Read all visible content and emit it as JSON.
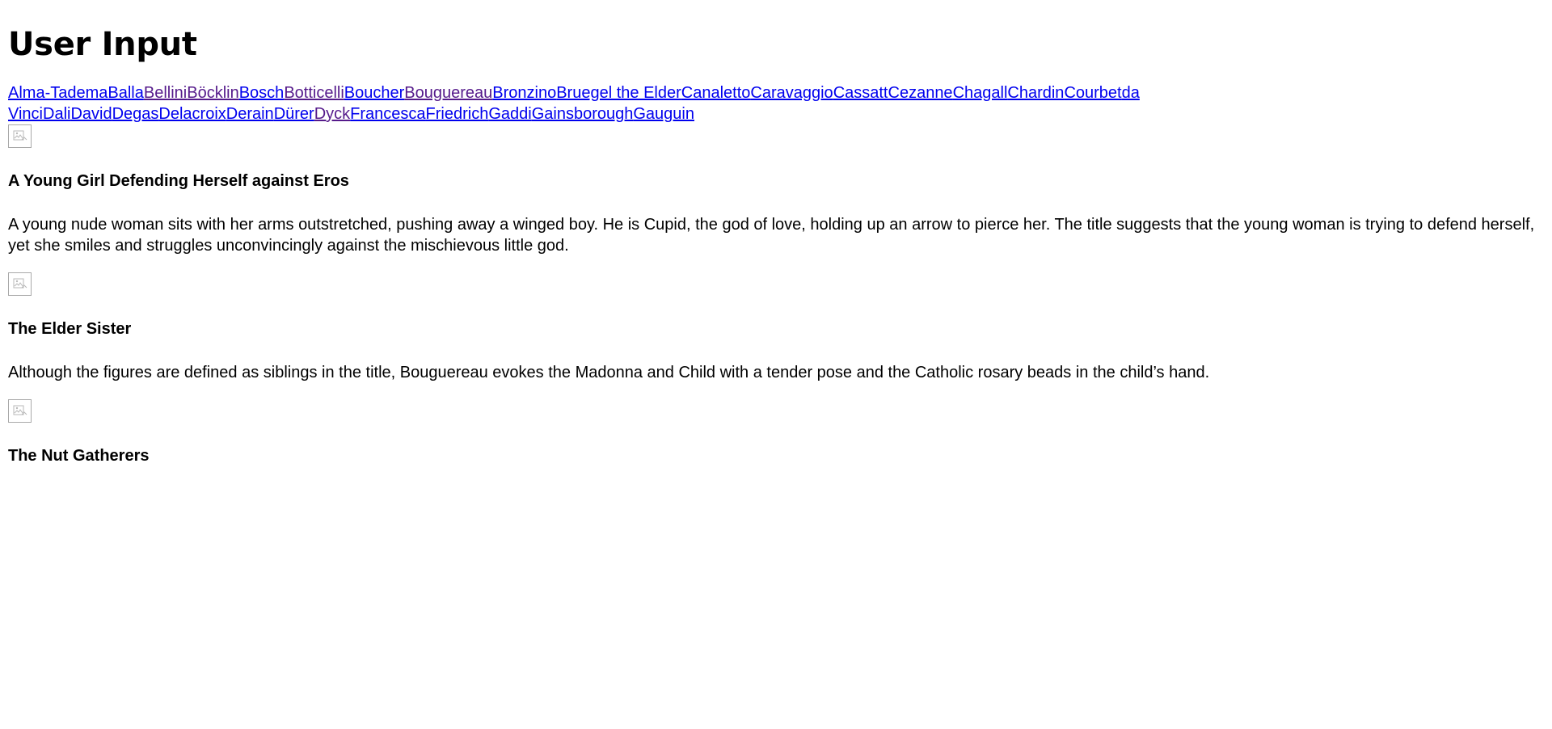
{
  "page": {
    "title": "User Input"
  },
  "artists": [
    {
      "label": "Alma-Tadema",
      "visited": false
    },
    {
      "label": "Balla",
      "visited": false
    },
    {
      "label": "Bellini",
      "visited": true
    },
    {
      "label": "Böcklin",
      "visited": true
    },
    {
      "label": "Bosch",
      "visited": false
    },
    {
      "label": "Botticelli",
      "visited": true
    },
    {
      "label": "Boucher",
      "visited": false
    },
    {
      "label": "Bouguereau",
      "visited": true
    },
    {
      "label": "Bronzino",
      "visited": false
    },
    {
      "label": "Bruegel the Elder",
      "visited": false
    },
    {
      "label": "Canaletto",
      "visited": false
    },
    {
      "label": "Caravaggio",
      "visited": false
    },
    {
      "label": "Cassatt",
      "visited": false
    },
    {
      "label": "Cezanne",
      "visited": false
    },
    {
      "label": "Chagall",
      "visited": false
    },
    {
      "label": "Chardin",
      "visited": false
    },
    {
      "label": "Courbet",
      "visited": false
    },
    {
      "label": "da Vinci",
      "visited": false
    },
    {
      "label": "Dali",
      "visited": false
    },
    {
      "label": "David",
      "visited": false
    },
    {
      "label": "Degas",
      "visited": false
    },
    {
      "label": "Delacroix",
      "visited": false
    },
    {
      "label": "Derain",
      "visited": false
    },
    {
      "label": "Dürer",
      "visited": false
    },
    {
      "label": "Dyck",
      "visited": true
    },
    {
      "label": "Francesca",
      "visited": false
    },
    {
      "label": "Friedrich",
      "visited": false
    },
    {
      "label": "Gaddi",
      "visited": false
    },
    {
      "label": "Gainsborough",
      "visited": false
    },
    {
      "label": "Gauguin",
      "visited": false
    }
  ],
  "artworks": [
    {
      "title": "A Young Girl Defending Herself against Eros",
      "description": "A young nude woman sits with her arms outstretched, pushing away a winged boy. He is Cupid, the god of love, holding up an arrow to pierce her. The title suggests that the young woman is trying to defend herself, yet she smiles and struggles unconvincingly against the mischievous little god."
    },
    {
      "title": "The Elder Sister",
      "description": "Although the figures are defined as siblings in the title, Bouguereau evokes the Madonna and Child with a tender pose and the Catholic rosary beads in the child’s hand."
    },
    {
      "title": "The Nut Gatherers",
      "description": ""
    }
  ],
  "colors": {
    "link": "#0000ee",
    "visited_link": "#551a8b",
    "text": "#000000",
    "background": "#ffffff",
    "image_border": "#a9a9a9"
  },
  "icons": {
    "broken_image": "broken-image-icon"
  }
}
